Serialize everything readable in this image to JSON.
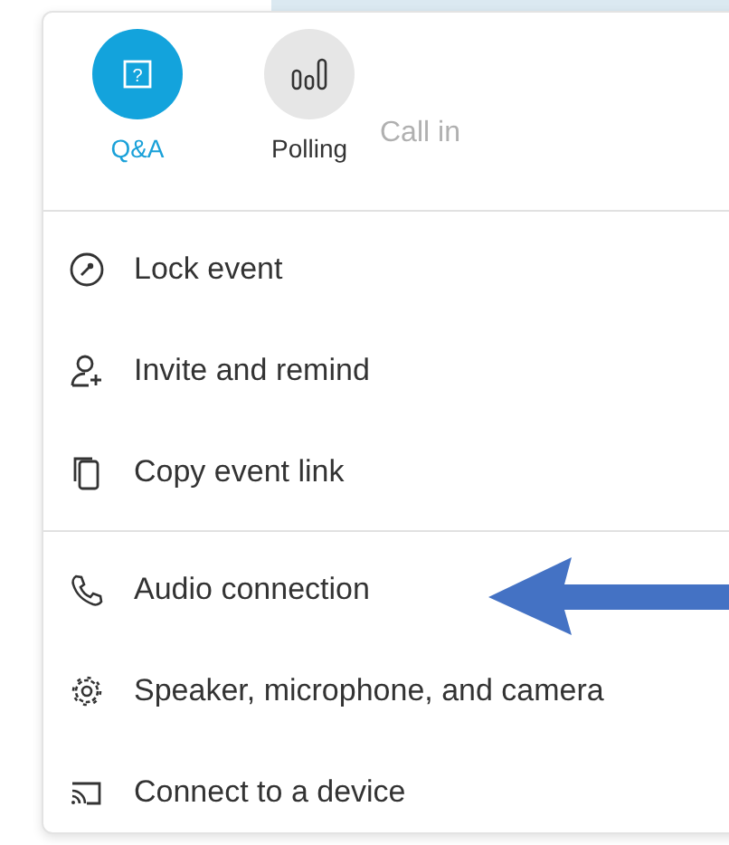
{
  "actions": [
    {
      "kind": "qa",
      "label": "Q&A",
      "icon_glyph": "?",
      "selected": true
    },
    {
      "kind": "polling",
      "label": "Polling",
      "selected": false
    }
  ],
  "background_text": "Call in",
  "menu_sections": [
    {
      "items": [
        {
          "kind": "lock",
          "label": "Lock event"
        },
        {
          "kind": "invite",
          "label": "Invite and remind"
        },
        {
          "kind": "copy",
          "label": "Copy event link"
        }
      ]
    },
    {
      "items": [
        {
          "kind": "phone",
          "label": "Audio connection"
        },
        {
          "kind": "gear",
          "label": "Speaker, microphone, and camera"
        },
        {
          "kind": "cast",
          "label": "Connect to a device"
        }
      ]
    }
  ]
}
